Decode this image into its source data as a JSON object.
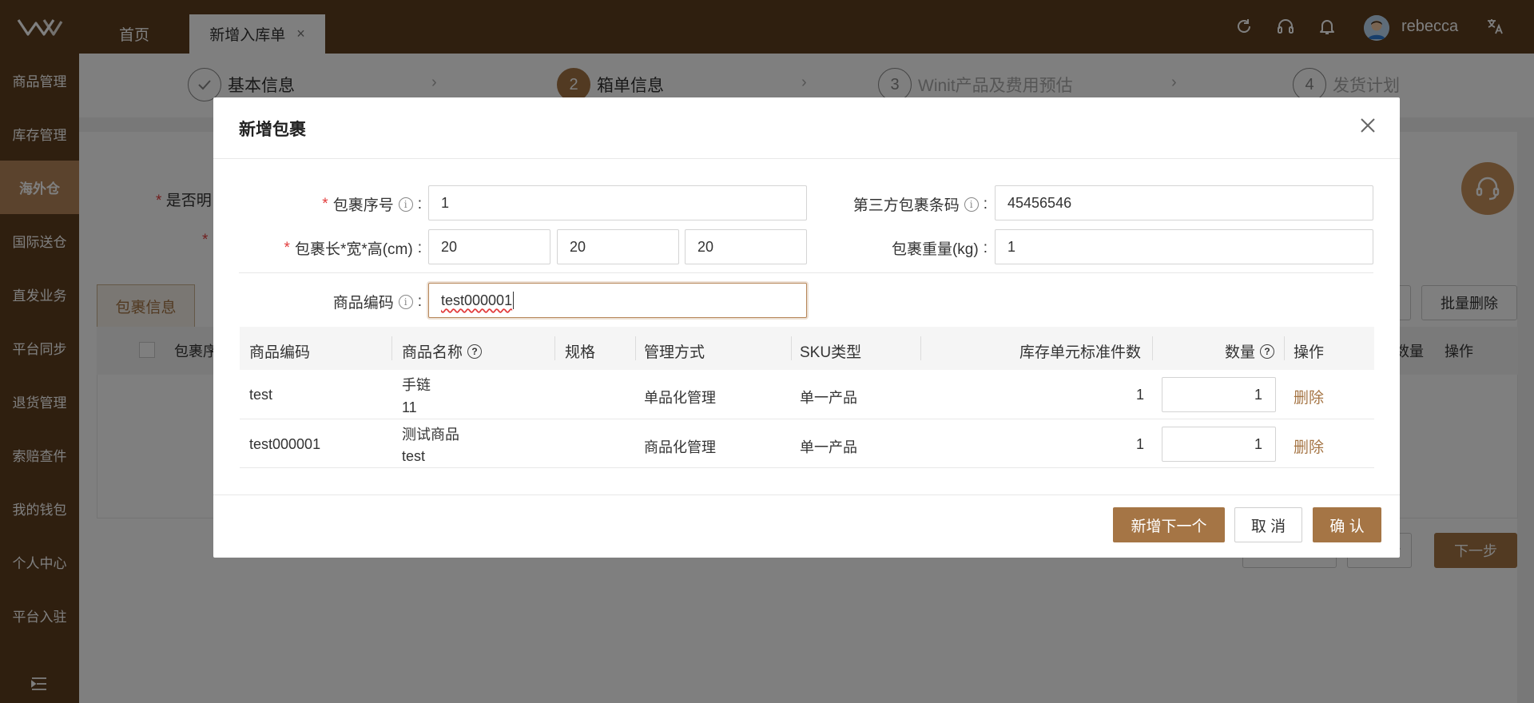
{
  "topbar": {
    "tabs": [
      {
        "label": "首页",
        "active": false
      },
      {
        "label": "新增入库单",
        "active": true,
        "close": "×"
      }
    ],
    "username": "rebecca",
    "icons": [
      "refresh-icon",
      "headset-icon",
      "bell-icon",
      "translate-icon"
    ]
  },
  "sidebar": {
    "items": [
      {
        "label": "商品管理"
      },
      {
        "label": "库存管理"
      },
      {
        "label": "海外仓",
        "active": true
      },
      {
        "label": "国际送仓"
      },
      {
        "label": "直发业务"
      },
      {
        "label": "平台同步"
      },
      {
        "label": "退货管理"
      },
      {
        "label": "索赔查件"
      },
      {
        "label": "我的钱包"
      },
      {
        "label": "个人中心"
      },
      {
        "label": "平台入驻"
      }
    ]
  },
  "steps": [
    {
      "num": "",
      "label": "基本信息",
      "state": "done"
    },
    {
      "num": "2",
      "label": "箱单信息",
      "state": "current"
    },
    {
      "num": "3",
      "label": "Winit产品及费用预估",
      "state": "todo"
    },
    {
      "num": "4",
      "label": "发货计划",
      "state": "todo"
    }
  ],
  "background": {
    "label1": "是否明",
    "tab_label": "包裹信息",
    "col_pkg": "包裹序",
    "col_qty": "数量",
    "col_op": "操作",
    "batch_delete": "批量删除",
    "prev_step": "上一步",
    "next_step": "下一步"
  },
  "modal": {
    "title": "新增包裹",
    "fields": {
      "pkg_no_label": "包裹序号",
      "pkg_no_value": "1",
      "third_barcode_label": "第三方包裹条码",
      "third_barcode_value": "45456546",
      "dims_label": "包裹长*宽*高(cm)",
      "dim_l": "20",
      "dim_w": "20",
      "dim_h": "20",
      "weight_label": "包裹重量(kg)",
      "weight_value": "1",
      "sku_label": "商品编码",
      "sku_value": "test000001"
    },
    "table": {
      "headers": [
        "商品编码",
        "商品名称",
        "规格",
        "管理方式",
        "SKU类型",
        "库存单元标准件数",
        "数量",
        "操作"
      ],
      "rows": [
        {
          "code": "test",
          "name": "手链",
          "name_sub": "11",
          "spec": "",
          "mgmt": "单品化管理",
          "sku_type": "单一产品",
          "std_qty": "1",
          "qty": "1",
          "action": "删除"
        },
        {
          "code": "test000001",
          "name": "测试商品",
          "name_sub": "test",
          "spec": "",
          "mgmt": "商品化管理",
          "sku_type": "单一产品",
          "std_qty": "1",
          "qty": "1",
          "action": "删除"
        }
      ]
    },
    "buttons": {
      "add_next": "新增下一个",
      "cancel": "取 消",
      "confirm": "确 认"
    }
  },
  "colors": {
    "brand_dark": "#5f3e1e",
    "accent": "#a57545",
    "sidebar_active": "#b7875a",
    "required": "#e23c3c"
  }
}
